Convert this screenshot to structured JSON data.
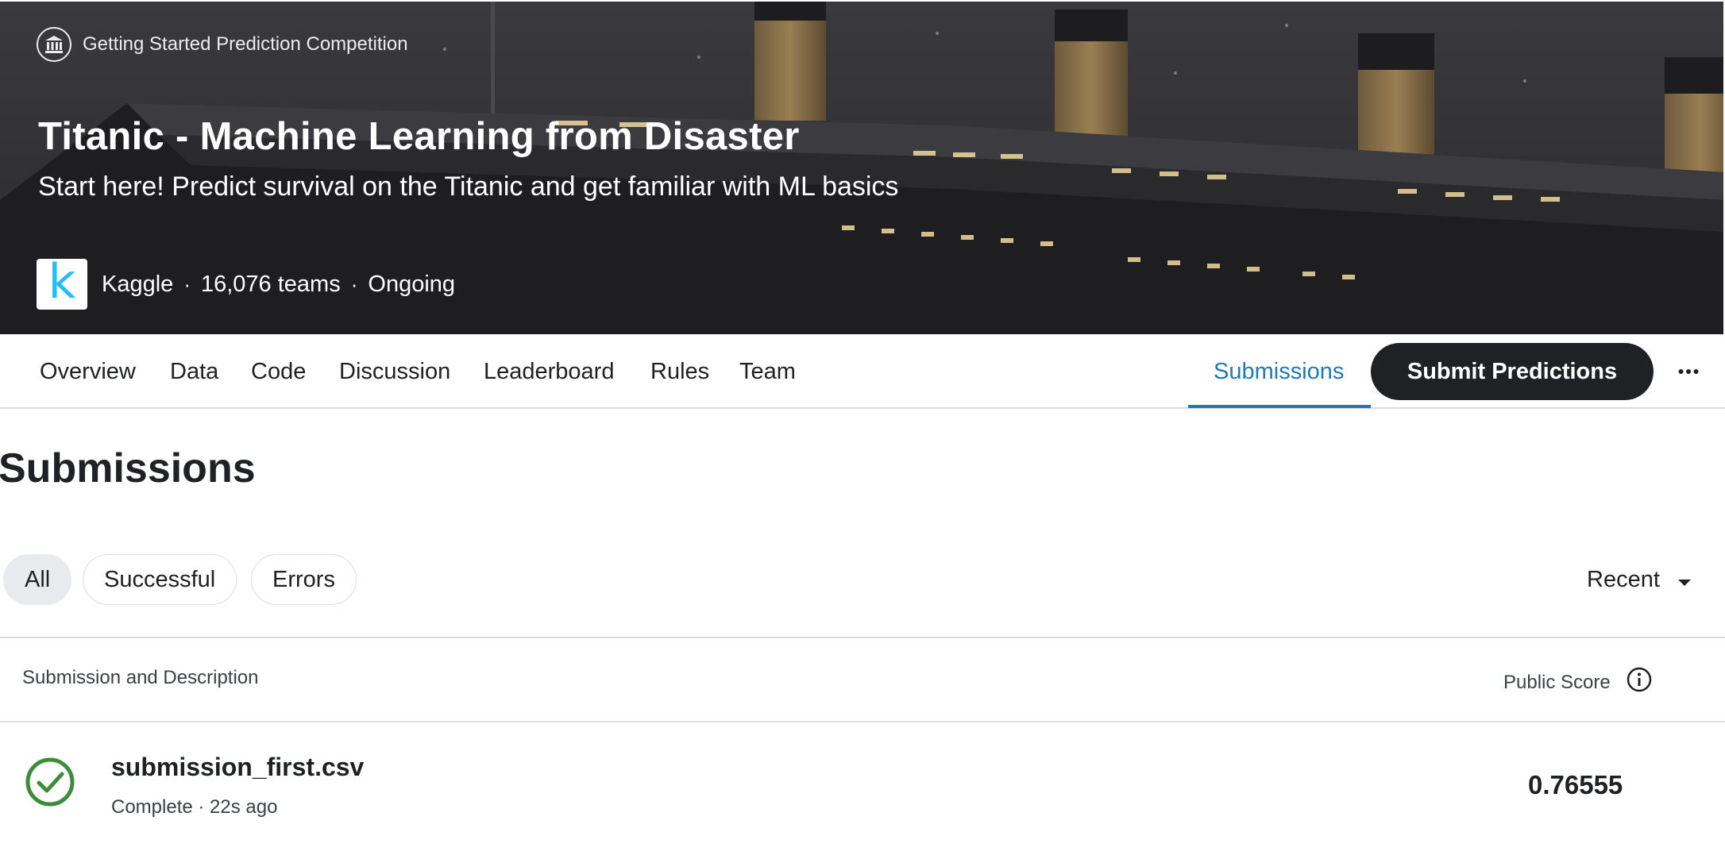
{
  "header": {
    "competition_type": "Getting Started Prediction Competition",
    "title": "Titanic - Machine Learning from Disaster",
    "subtitle": "Start here! Predict survival on the Titanic and get familiar with ML basics",
    "host_logo_letter": "k",
    "host": "Kaggle",
    "separator": "·",
    "teams": "16,076 teams",
    "status": "Ongoing"
  },
  "nav": {
    "tabs": [
      {
        "label": "Overview"
      },
      {
        "label": "Data"
      },
      {
        "label": "Code"
      },
      {
        "label": "Discussion"
      },
      {
        "label": "Leaderboard"
      },
      {
        "label": "Rules"
      },
      {
        "label": "Team"
      }
    ],
    "active_tab": {
      "label": "Submissions"
    },
    "submit_label": "Submit Predictions",
    "more_icon": "more-horizontal-icon",
    "accent_color": "#1f7bb6"
  },
  "submissions": {
    "heading": "Submissions",
    "filters": [
      {
        "label": "All",
        "selected": true
      },
      {
        "label": "Successful",
        "selected": false
      },
      {
        "label": "Errors",
        "selected": false
      }
    ],
    "sort": {
      "label": "Recent",
      "icon": "caret-down-icon"
    },
    "columns": {
      "description": "Submission and Description",
      "score": "Public Score",
      "score_info_icon": "info-icon"
    },
    "rows": [
      {
        "file_name": "submission_first.csv",
        "status": "Complete · 22s ago",
        "public_score": "0.76555",
        "status_icon": "check-circle-icon",
        "status_color": "#3c8d3a"
      }
    ]
  }
}
